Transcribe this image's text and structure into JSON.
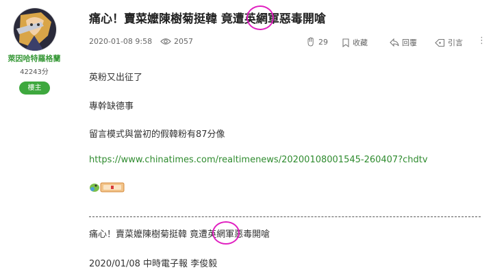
{
  "author": {
    "name": "萊因哈特羅格蘭",
    "points": "42243分",
    "badge": "樓主"
  },
  "post": {
    "title": "痛心！賣菜嬤陳樹菊挺韓 竟遭英網軍惡毒開嗆",
    "date": "2020-01-08 9:58",
    "views": "2057",
    "likes": "29",
    "bookmark_label": "收藏",
    "reply_label": "回覆",
    "quote_label": "引言",
    "lines": [
      "英粉又出征了",
      "專幹缺德事",
      "留言模式與當初的假韓粉有87分像"
    ],
    "link": "https://www.chinatimes.com/realtimenews/20200108001545-260407?chdtv",
    "quoted_title": "痛心！賣菜嬤陳樹菊挺韓 竟遭英網軍惡毒開嗆",
    "source_line": "2020/01/08 中時電子報 李俊毅"
  },
  "colors": {
    "accent_green": "#3ea83e",
    "link_green": "#2e8b2e",
    "annotation_magenta": "#e020c0"
  }
}
